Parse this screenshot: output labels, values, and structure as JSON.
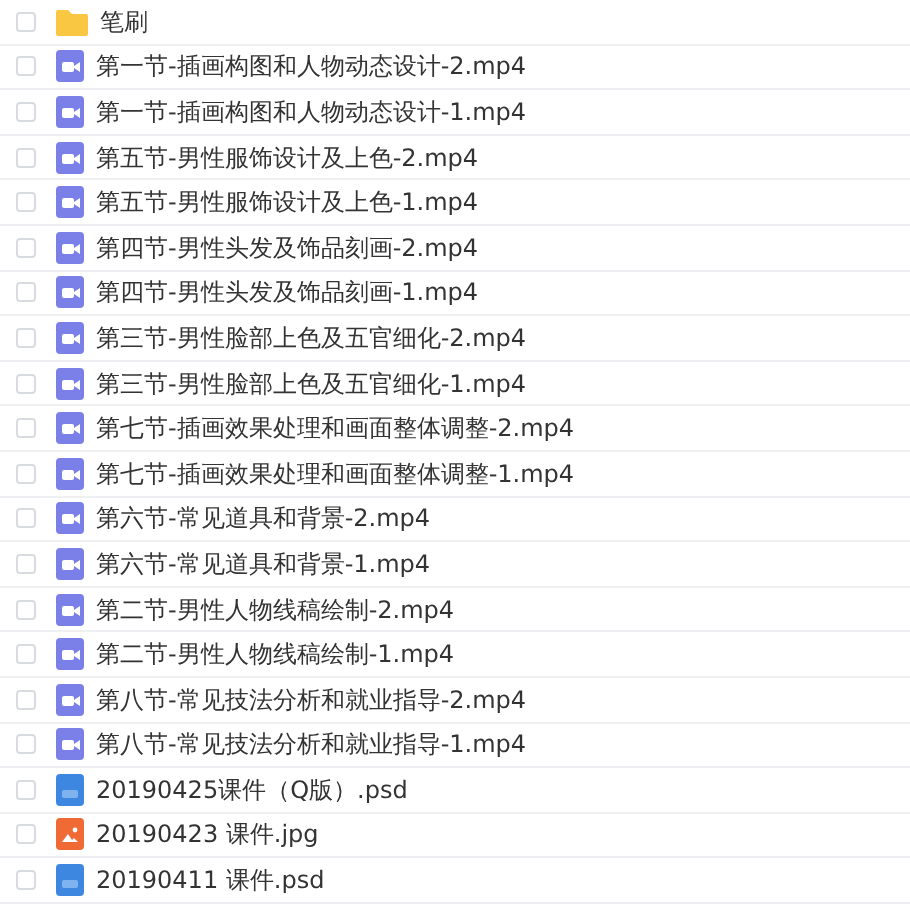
{
  "files": [
    {
      "name": "笔刷",
      "kind": "folder",
      "checked": false
    },
    {
      "name": "第一节-插画构图和人物动态设计-2.mp4",
      "kind": "video",
      "checked": false
    },
    {
      "name": "第一节-插画构图和人物动态设计-1.mp4",
      "kind": "video",
      "checked": false
    },
    {
      "name": "第五节-男性服饰设计及上色-2.mp4",
      "kind": "video",
      "checked": false
    },
    {
      "name": "第五节-男性服饰设计及上色-1.mp4",
      "kind": "video",
      "checked": false
    },
    {
      "name": "第四节-男性头发及饰品刻画-2.mp4",
      "kind": "video",
      "checked": false
    },
    {
      "name": "第四节-男性头发及饰品刻画-1.mp4",
      "kind": "video",
      "checked": false
    },
    {
      "name": "第三节-男性脸部上色及五官细化-2.mp4",
      "kind": "video",
      "checked": false
    },
    {
      "name": "第三节-男性脸部上色及五官细化-1.mp4",
      "kind": "video",
      "checked": false
    },
    {
      "name": "第七节-插画效果处理和画面整体调整-2.mp4",
      "kind": "video",
      "checked": false
    },
    {
      "name": "第七节-插画效果处理和画面整体调整-1.mp4",
      "kind": "video",
      "checked": false
    },
    {
      "name": "第六节-常见道具和背景-2.mp4",
      "kind": "video",
      "checked": false
    },
    {
      "name": "第六节-常见道具和背景-1.mp4",
      "kind": "video",
      "checked": false
    },
    {
      "name": "第二节-男性人物线稿绘制-2.mp4",
      "kind": "video",
      "checked": false
    },
    {
      "name": "第二节-男性人物线稿绘制-1.mp4",
      "kind": "video",
      "checked": false
    },
    {
      "name": "第八节-常见技法分析和就业指导-2.mp4",
      "kind": "video",
      "checked": false
    },
    {
      "name": "第八节-常见技法分析和就业指导-1.mp4",
      "kind": "video",
      "checked": false
    },
    {
      "name": "20190425课件（Q版）.psd",
      "kind": "psd",
      "checked": false
    },
    {
      "name": "20190423 课件.jpg",
      "kind": "image",
      "checked": false
    },
    {
      "name": "20190411 课件.psd",
      "kind": "psd",
      "checked": false
    }
  ]
}
